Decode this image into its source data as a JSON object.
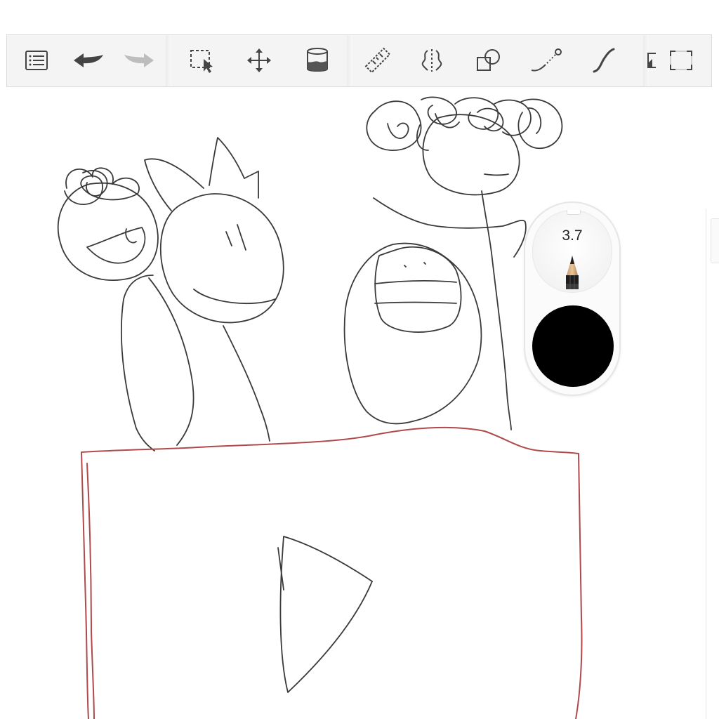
{
  "toolbar": {
    "tools": [
      {
        "id": "menu",
        "icon": "list-menu-icon"
      },
      {
        "id": "undo",
        "icon": "undo-arrow-icon"
      },
      {
        "id": "redo",
        "icon": "redo-arrow-icon",
        "state": "disabled"
      },
      {
        "id": "select",
        "icon": "selection-marquee-icon"
      },
      {
        "id": "transform",
        "icon": "move-arrows-icon"
      },
      {
        "id": "fill",
        "icon": "paint-bucket-icon"
      },
      {
        "id": "ruler",
        "icon": "ruler-icon"
      },
      {
        "id": "symmetry",
        "icon": "symmetry-icon"
      },
      {
        "id": "shapes",
        "icon": "shapes-icon"
      },
      {
        "id": "stroke",
        "icon": "predictive-stroke-icon"
      },
      {
        "id": "curve",
        "icon": "french-curve-icon"
      },
      {
        "id": "frame",
        "icon": "frame-icon"
      },
      {
        "id": "fullscreen",
        "icon": "fullscreen-icon"
      }
    ]
  },
  "brush": {
    "size_label": "3.7",
    "tool_icon": "pencil-icon",
    "color": "#000000"
  },
  "colors": {
    "stroke_primary": "#3a3a3a",
    "stroke_accent": "#b04a4a",
    "toolbar_bg": "#f4f4f4",
    "icon": "#444444",
    "icon_disabled": "#bdbdbd"
  }
}
